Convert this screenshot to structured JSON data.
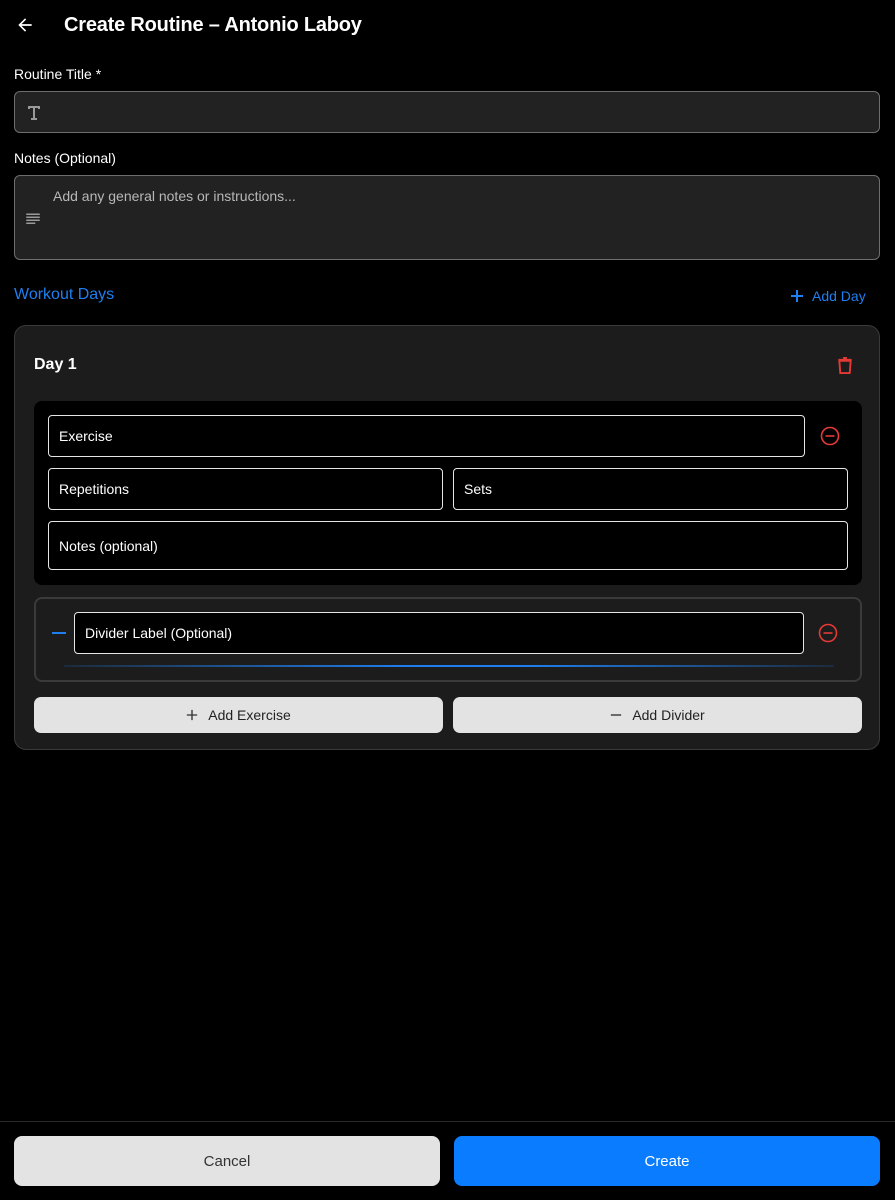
{
  "header": {
    "title": "Create Routine – Antonio Laboy",
    "back_icon": "arrow-left-icon"
  },
  "form": {
    "title_label": "Routine Title *",
    "title_value": "",
    "title_placeholder": "",
    "title_icon": "text-t-icon",
    "notes_label": "Notes (Optional)",
    "notes_value": "",
    "notes_placeholder": "Add any general notes or instructions...",
    "notes_icon": "notes-lines-icon"
  },
  "workout_days": {
    "section_title": "Workout Days",
    "add_day_label": "Add Day",
    "days": [
      {
        "title": "Day 1",
        "exercise": {
          "exercise_placeholder": "Exercise",
          "repetitions_placeholder": "Repetitions",
          "sets_placeholder": "Sets",
          "notes_placeholder": "Notes (optional)"
        },
        "divider": {
          "label_placeholder": "Divider Label (Optional)"
        },
        "add_exercise_label": "Add Exercise",
        "add_divider_label": "Add Divider"
      }
    ]
  },
  "footer": {
    "cancel_label": "Cancel",
    "create_label": "Create"
  },
  "colors": {
    "accent": "#1f7ff0",
    "primary_button": "#0a7cff",
    "danger": "#e53935",
    "background": "#000000"
  }
}
